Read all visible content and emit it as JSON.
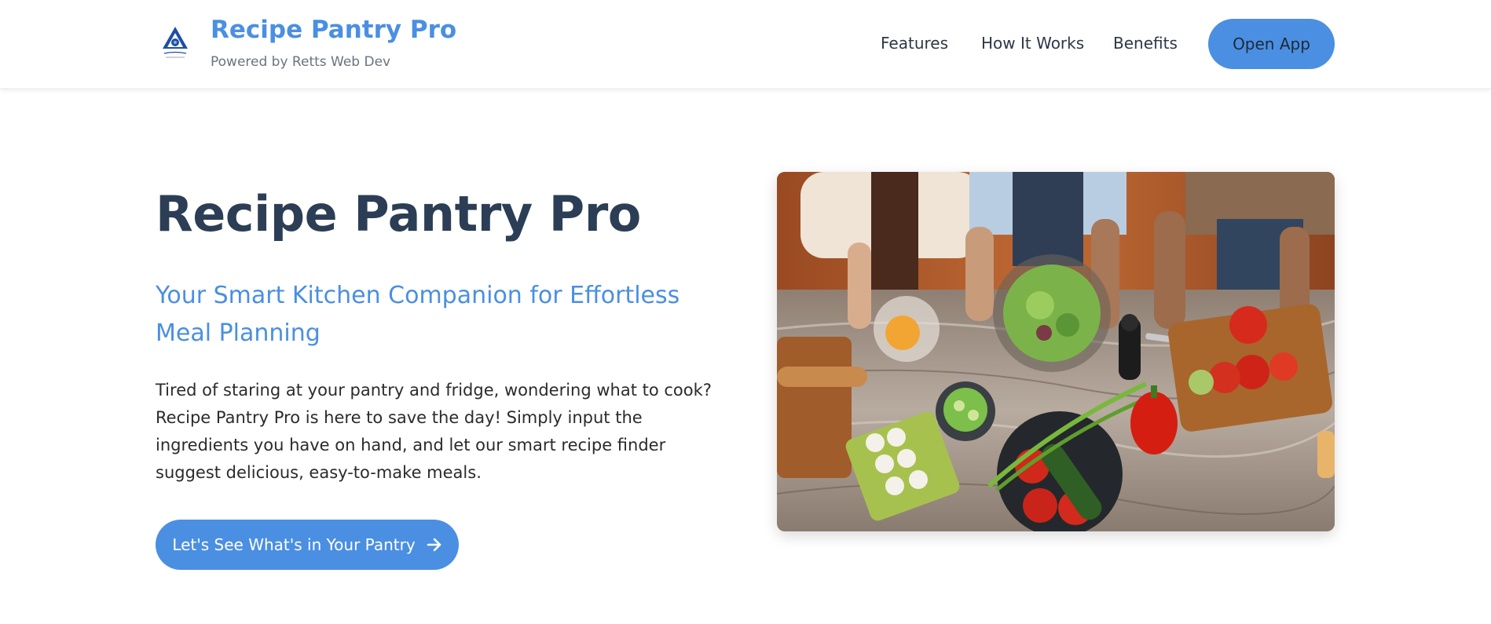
{
  "header": {
    "brand_title": "Recipe Pantry Pro",
    "brand_subtitle": "Powered by Retts Web Dev",
    "logo_icon": "triangle-eye-logo-icon",
    "nav": {
      "features": "Features",
      "how_it_works": "How It Works",
      "benefits": "Benefits"
    },
    "open_app_label": "Open App"
  },
  "hero": {
    "title": "Recipe Pantry Pro",
    "subtitle": "Your Smart Kitchen Companion for Effortless Meal Planning",
    "description": "Tired of staring at your pantry and fridge, wondering what to cook? Recipe Pantry Pro is here to save the day! Simply input the ingredients you have on hand, and let our smart recipe finder suggest delicious, easy-to-make meals.",
    "cta_label": "Let's See What's in Your Pantry",
    "cta_icon": "arrow-right-icon",
    "image_subject": "family-cooking-photo"
  },
  "colors": {
    "accent": "#4a8fe2",
    "title_dark": "#2c3e55",
    "text": "#2b2b2b"
  }
}
